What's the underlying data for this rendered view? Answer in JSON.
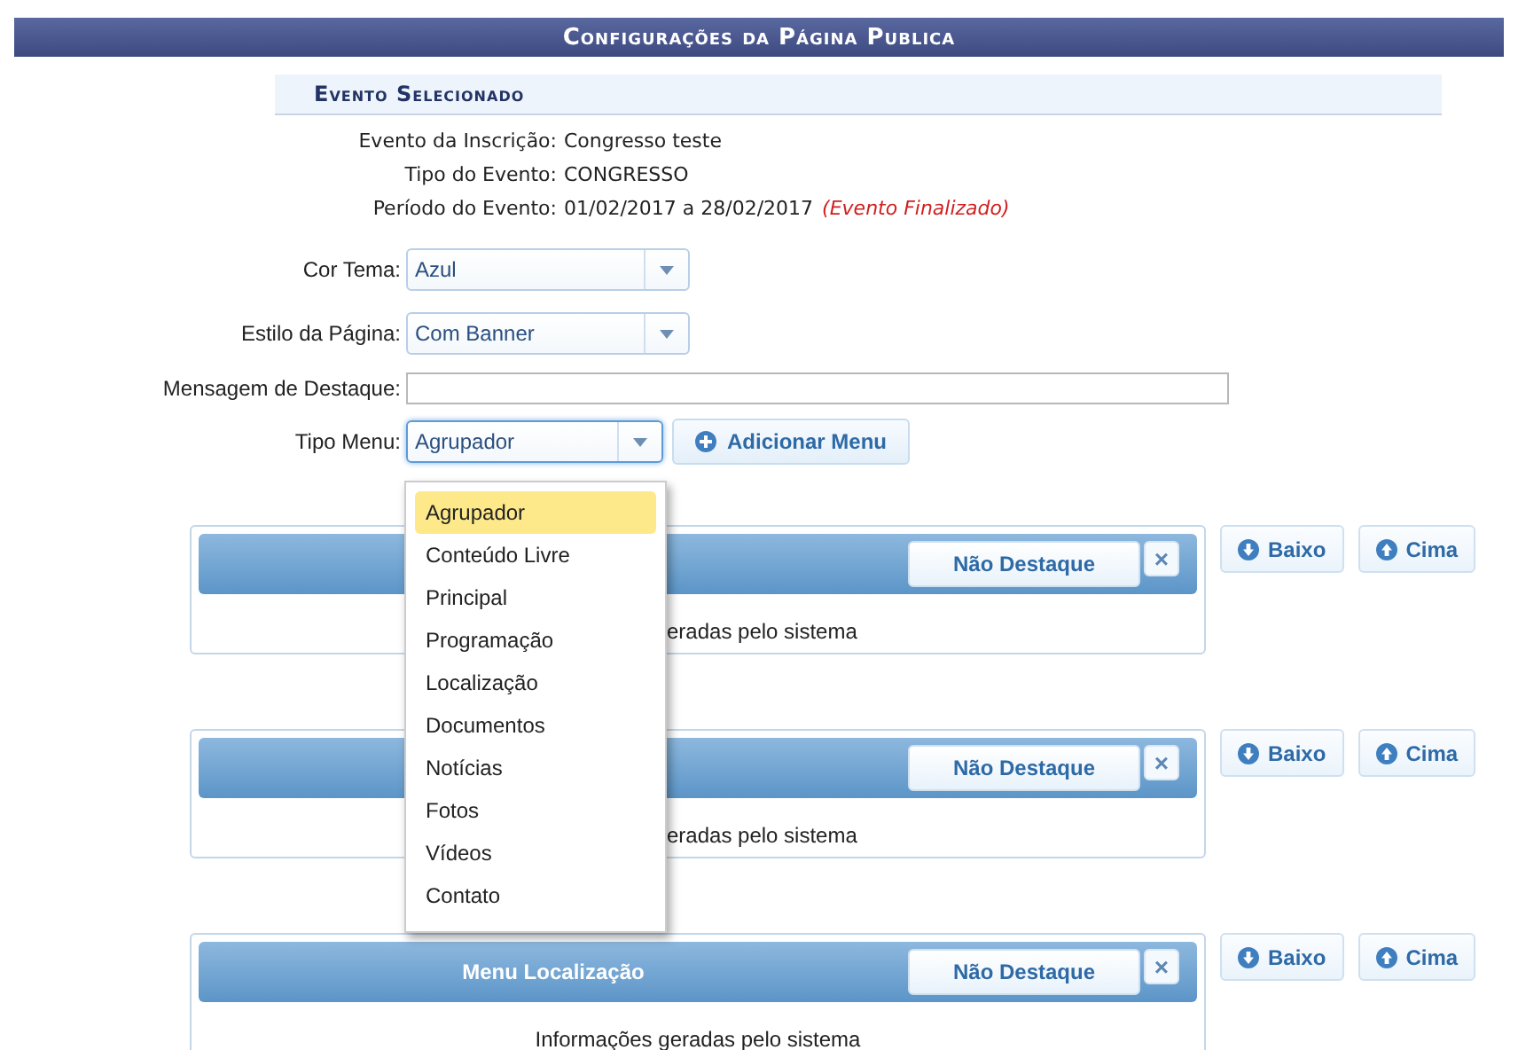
{
  "header": {
    "title": "Configurações da Página Publica"
  },
  "event": {
    "title": "Evento Selecionado",
    "rows": [
      {
        "label": "Evento da Inscrição:",
        "value": "Congresso teste"
      },
      {
        "label": "Tipo do Evento:",
        "value": "CONGRESSO"
      },
      {
        "label": "Período do Evento:",
        "value": "01/02/2017 a 28/02/2017",
        "note": "(Evento Finalizado)"
      }
    ]
  },
  "form": {
    "cor_tema": {
      "label": "Cor Tema:",
      "value": "Azul"
    },
    "estilo": {
      "label": "Estilo da Página:",
      "value": "Com Banner"
    },
    "mensagem": {
      "label": "Mensagem de Destaque:"
    },
    "tipo_menu": {
      "label": "Tipo Menu:",
      "value": "Agrupador",
      "expanded": true,
      "options": [
        {
          "label": "Agrupador",
          "selected": true
        },
        {
          "label": "Conteúdo Livre",
          "selected": false
        },
        {
          "label": "Principal",
          "selected": false
        },
        {
          "label": "Programação",
          "selected": false
        },
        {
          "label": "Localização",
          "selected": false
        },
        {
          "label": "Documentos",
          "selected": false
        },
        {
          "label": "Notícias",
          "selected": false
        },
        {
          "label": "Fotos",
          "selected": false
        },
        {
          "label": "Vídeos",
          "selected": false
        },
        {
          "label": "Contato",
          "selected": false
        }
      ]
    },
    "add_button": "Adicionar Menu"
  },
  "panels": [
    {
      "body": "eradas pelo sistema",
      "highlight_button": "Não Destaque",
      "close": "×",
      "down": "Baixo",
      "up": "Cima"
    },
    {
      "body": "eradas pelo sistema",
      "highlight_button": "Não Destaque",
      "close": "×",
      "down": "Baixo",
      "up": "Cima"
    },
    {
      "title": "Menu Localização",
      "body": "Informações geradas pelo sistema",
      "highlight_button": "Não Destaque",
      "close": "×",
      "down": "Baixo",
      "up": "Cima"
    }
  ]
}
